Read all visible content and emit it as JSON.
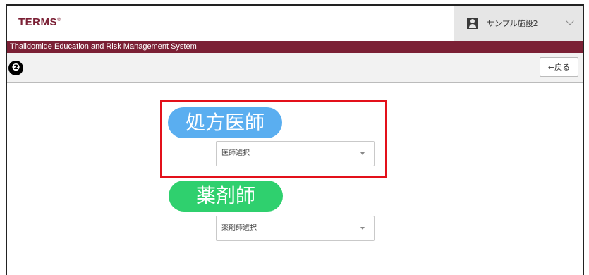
{
  "header": {
    "logo_text": "TERMS",
    "logo_mark": "®",
    "facility_name": "サンプル施設2",
    "system_name": "Thalidomide Education and Risk Management System"
  },
  "toolbar": {
    "step_marker": "❷",
    "back_label": "←戻る"
  },
  "form": {
    "doctor": {
      "label": "処方医師",
      "select_placeholder": "医師選択",
      "label_color": "#5aaef0"
    },
    "pharmacist": {
      "label": "薬剤師",
      "select_placeholder": "薬剤師選択",
      "label_color": "#2fd06e"
    }
  },
  "colors": {
    "brand": "#7b2035",
    "highlight": "#e3101a"
  }
}
